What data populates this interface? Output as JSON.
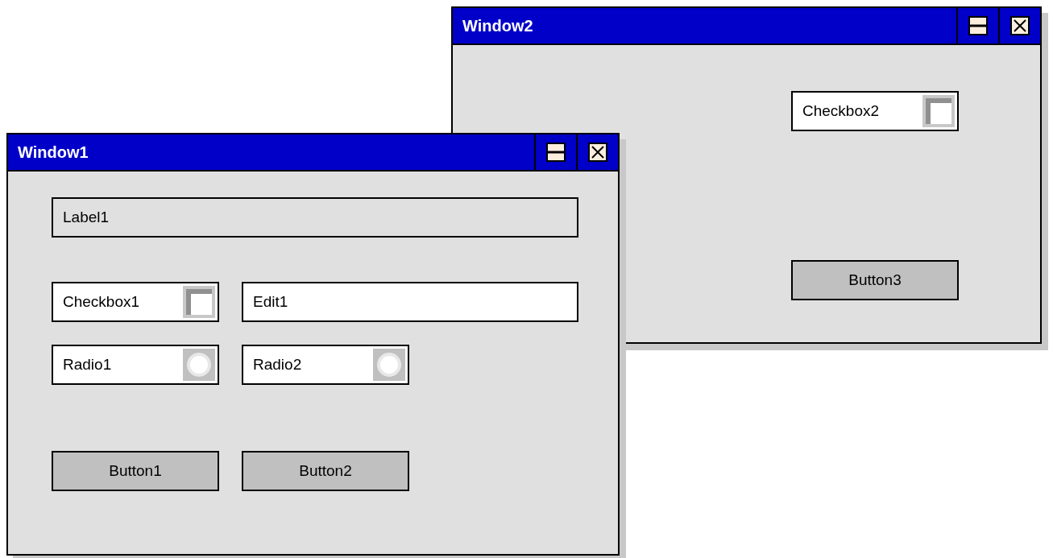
{
  "windows": [
    {
      "title": "Window2",
      "controls": [
        {
          "kind": "checkbox",
          "label": "Checkbox2",
          "checked": false
        },
        {
          "kind": "button",
          "label": "Button3"
        }
      ]
    },
    {
      "title": "Window1",
      "controls": [
        {
          "kind": "label",
          "label": "Label1"
        },
        {
          "kind": "checkbox",
          "label": "Checkbox1",
          "checked": false
        },
        {
          "kind": "edit",
          "value": "Edit1"
        },
        {
          "kind": "radio",
          "label": "Radio1",
          "selected": false
        },
        {
          "kind": "radio",
          "label": "Radio2",
          "selected": false
        },
        {
          "kind": "button",
          "label": "Button1"
        },
        {
          "kind": "button",
          "label": "Button2"
        }
      ]
    }
  ]
}
